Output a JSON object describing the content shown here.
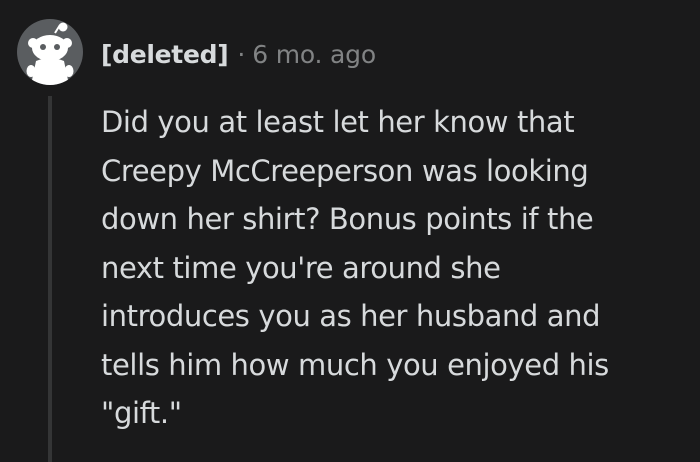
{
  "comment": {
    "author": "[deleted]",
    "separator": "·",
    "timestamp": "6 mo. ago",
    "body_lines": [
      "Did you at least let her know that",
      "Creepy McCreeperson was looking",
      "down her shirt? Bonus points if the",
      "next time you're around she",
      "introduces you as her husband and",
      "tells him how much you enjoyed his",
      "\"gift.\""
    ],
    "avatar_icon": "reddit-snoo-icon"
  },
  "colors": {
    "background": "#1a1a1b",
    "text": "#d7dadc",
    "meta_text": "#818384",
    "avatar_bg": "#5a5d60",
    "thread_line": "#343536"
  }
}
